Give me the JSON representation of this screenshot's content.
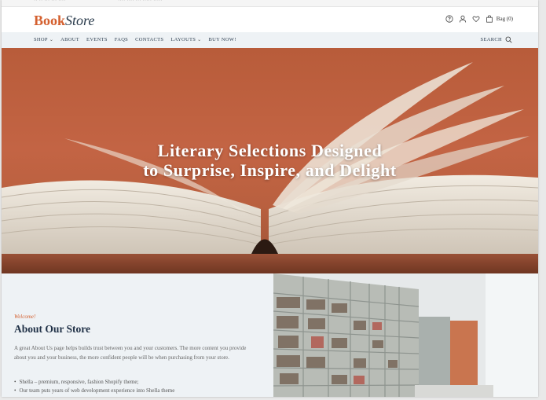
{
  "header": {
    "logo_part1": "Book",
    "logo_part2": "Store",
    "bag_label": "Bag (0)"
  },
  "nav": {
    "items": [
      {
        "label": "SHOP",
        "has_dropdown": true
      },
      {
        "label": "ABOUT",
        "has_dropdown": false
      },
      {
        "label": "EVENTS",
        "has_dropdown": false
      },
      {
        "label": "FAQS",
        "has_dropdown": false
      },
      {
        "label": "CONTACTS",
        "has_dropdown": false
      },
      {
        "label": "LAYOUTS",
        "has_dropdown": true
      },
      {
        "label": "BUY NOW!",
        "has_dropdown": false
      }
    ],
    "search_label": "SEARCH"
  },
  "icons": {
    "help": "question-circle-icon",
    "account": "user-icon",
    "wishlist": "heart-icon",
    "bag": "shopping-bag-icon",
    "search": "search-icon"
  },
  "hero": {
    "line1": "Literary Selections Designed",
    "line2": "to Surprise, Inspire, and Delight"
  },
  "about": {
    "welcome": "Welcome!",
    "title": "About Our Store",
    "description": "A great About Us page helps builds trust between you and your customers. The more content you provide about you and your business, the more confident people will be when purchasing from your store.",
    "bullets": [
      "Shella – premium, responsive, fashion Shopify theme;",
      "Our team puts years of web development experience into Shella theme"
    ]
  },
  "colors": {
    "accent": "#d4602f",
    "navy": "#1f3046",
    "nav_bg": "#eef2f5",
    "hero_bg": "#c36444"
  }
}
